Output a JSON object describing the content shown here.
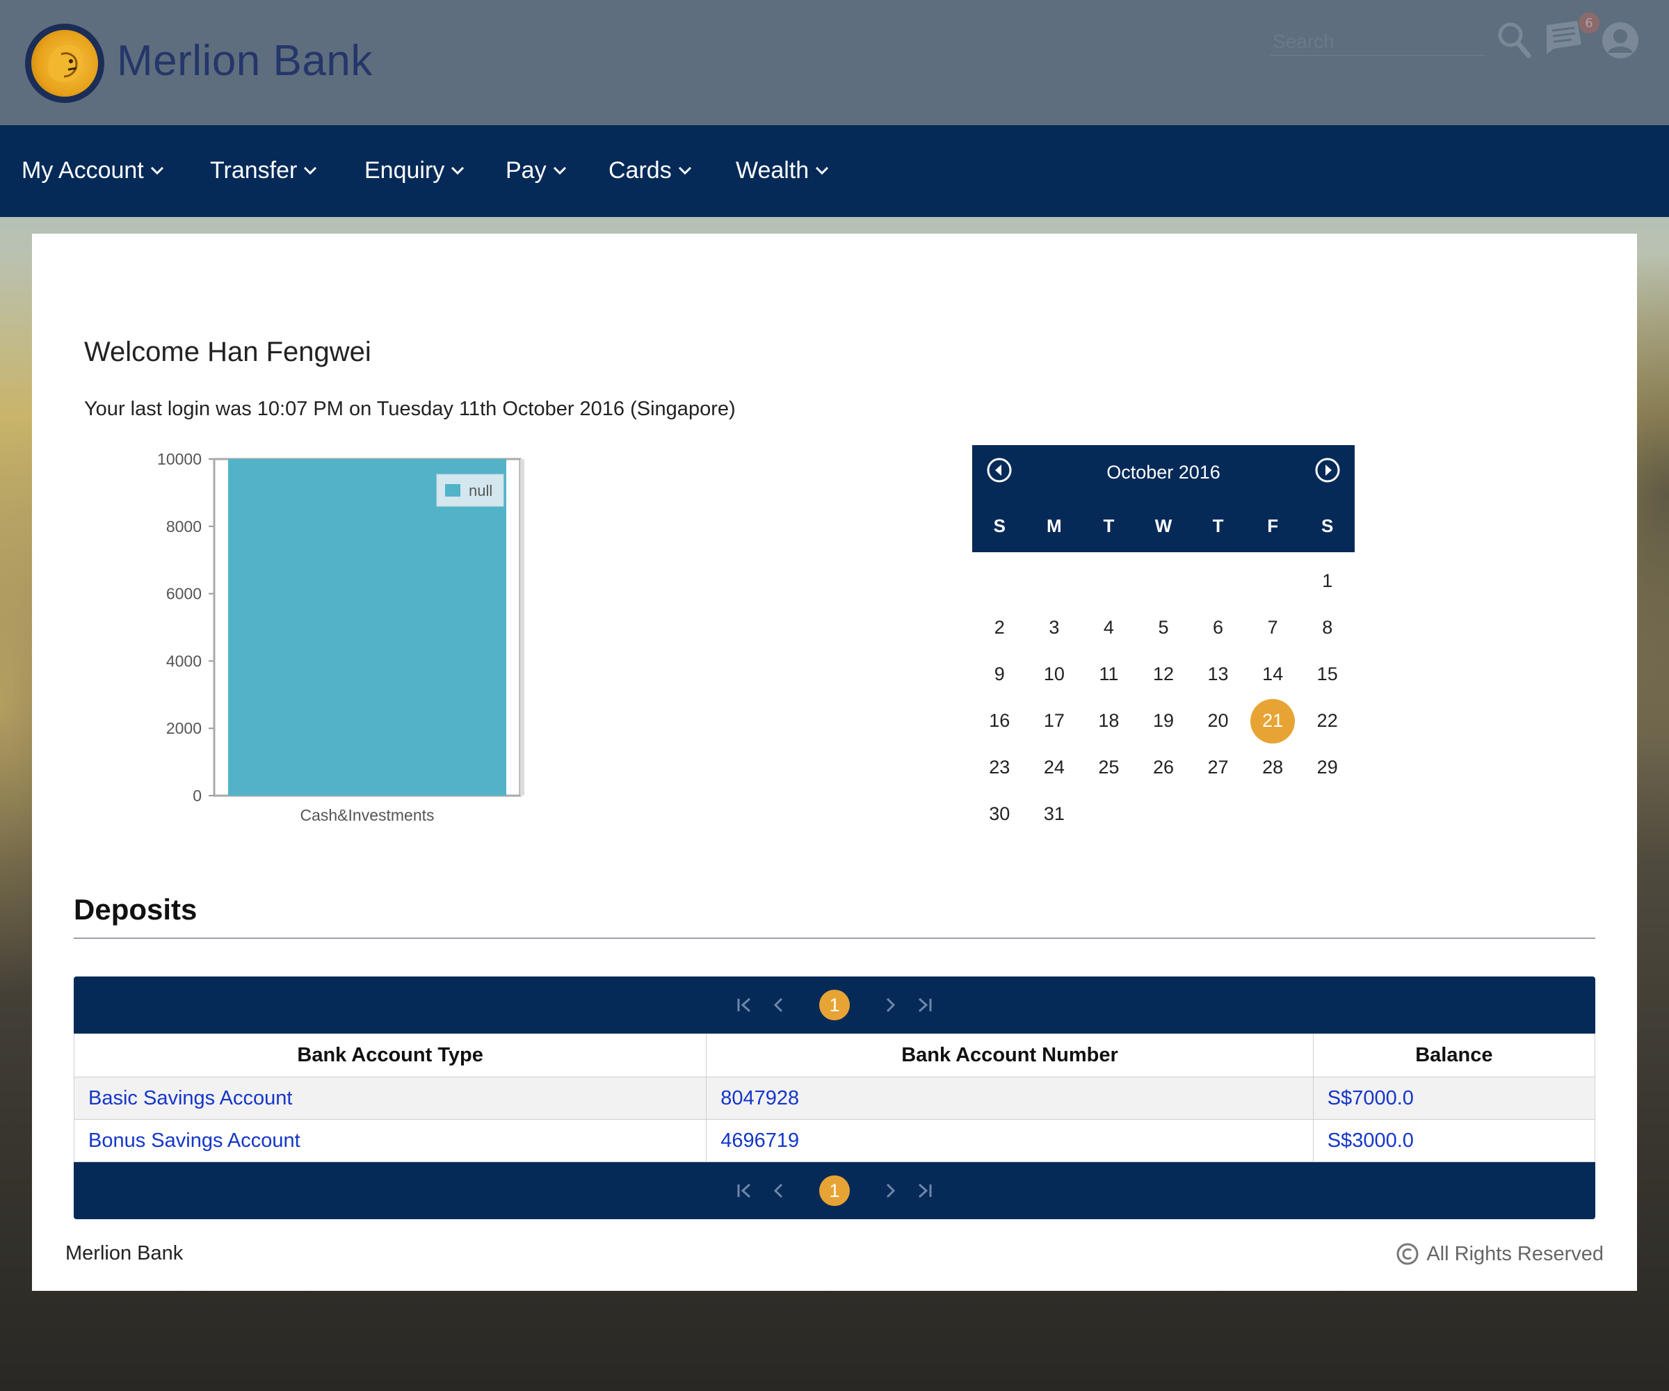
{
  "header": {
    "brand": "Merlion Bank",
    "search_placeholder": "Search",
    "notification_count": "6"
  },
  "nav": {
    "items": [
      {
        "label": "My Account"
      },
      {
        "label": "Transfer"
      },
      {
        "label": "Enquiry"
      },
      {
        "label": "Pay"
      },
      {
        "label": "Cards"
      },
      {
        "label": "Wealth"
      }
    ]
  },
  "welcome": {
    "title": "Welcome Han Fengwei",
    "last_login": "Your last login was 10:07 PM on Tuesday 11th October 2016 (Singapore)"
  },
  "chart_data": {
    "type": "bar",
    "categories": [
      "Cash&Investments"
    ],
    "series": [
      {
        "name": "null",
        "values": [
          10000
        ]
      }
    ],
    "ylim": [
      0,
      10000
    ],
    "yticks": [
      0,
      2000,
      4000,
      6000,
      8000,
      10000
    ],
    "ytick_labels": [
      "0",
      "2000",
      "4000",
      "6000",
      "8000",
      "10000"
    ],
    "legend": "top-right",
    "bar_color": "#52b3c8"
  },
  "calendar": {
    "month_label": "October 2016",
    "weekdays": [
      "S",
      "M",
      "T",
      "W",
      "T",
      "F",
      "S"
    ],
    "first_weekday_index": 6,
    "days_in_month": 31,
    "today": 21,
    "highlight_color": "#e7a434"
  },
  "deposits": {
    "title": "Deposits",
    "pager_current": "1",
    "columns": [
      "Bank Account Type",
      "Bank Account Number",
      "Balance"
    ],
    "rows": [
      [
        "Basic Savings Account",
        "8047928",
        "S$7000.0"
      ],
      [
        "Bonus Savings Account",
        "4696719",
        "S$3000.0"
      ]
    ]
  },
  "footer": {
    "left": "Merlion Bank",
    "right": "All Rights Reserved"
  },
  "colors": {
    "nav_bg": "#062a58",
    "header_bg": "#5e6e7e",
    "accent": "#e7a434",
    "link": "#1436c9"
  }
}
